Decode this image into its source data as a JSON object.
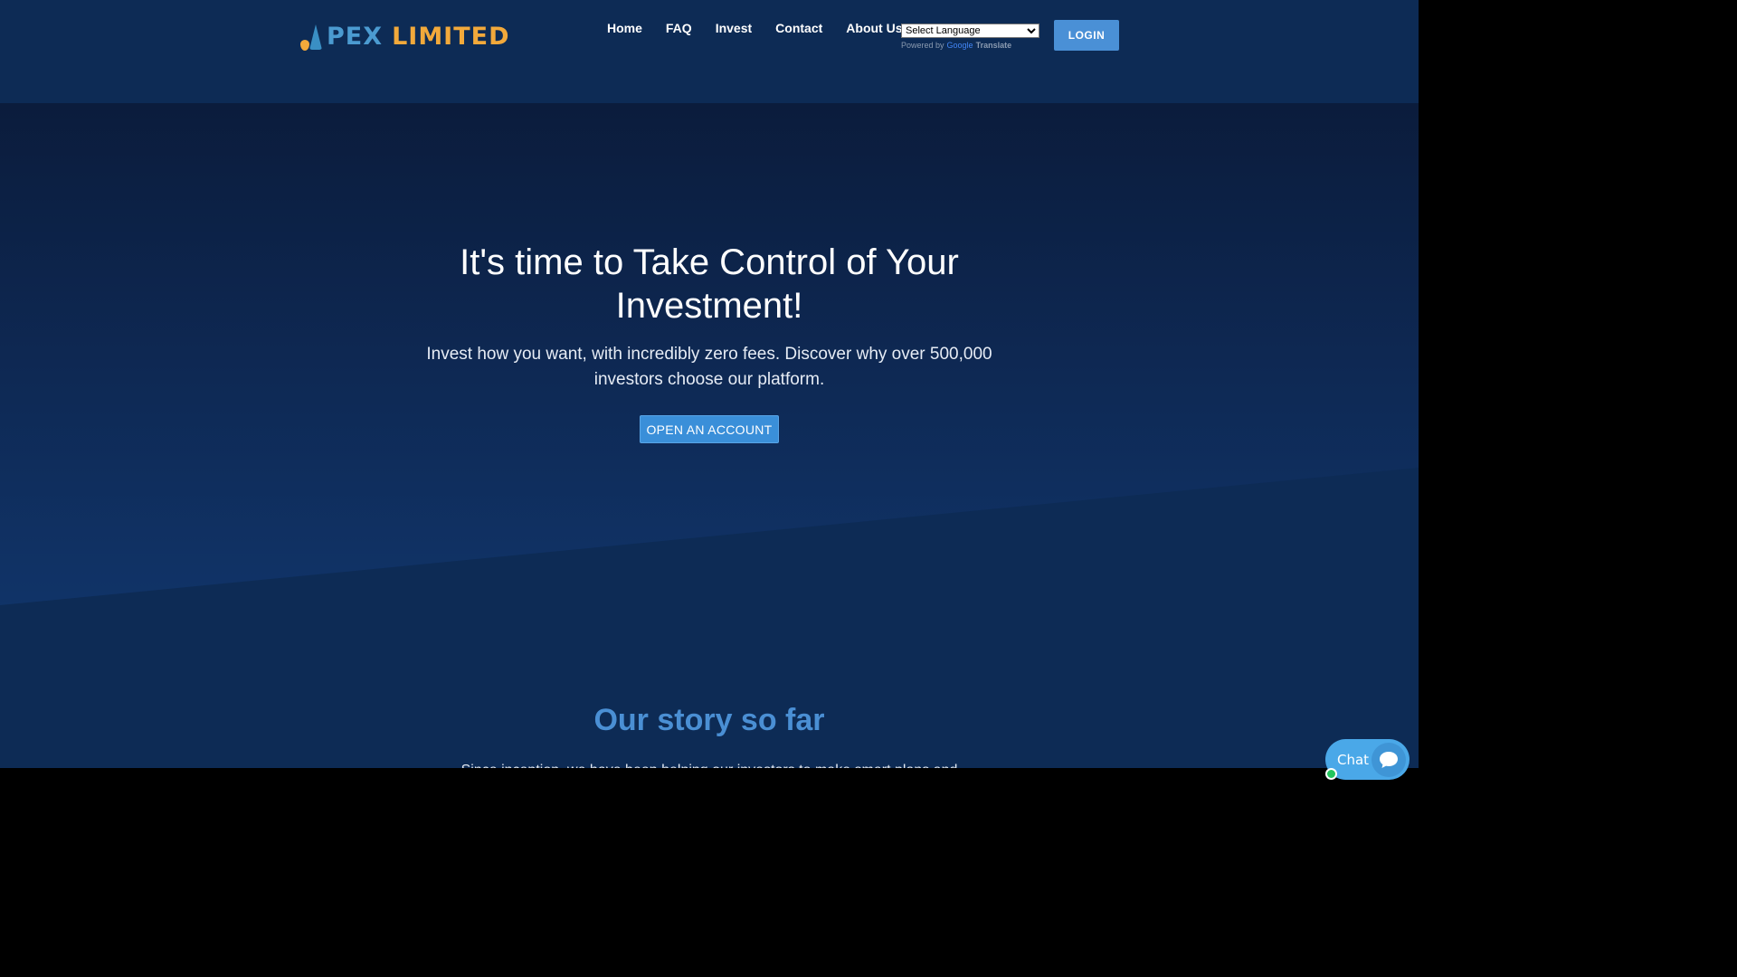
{
  "header": {
    "logo": {
      "part1": "PEX",
      "part2": "LIMITED"
    },
    "nav": [
      {
        "label": "Home"
      },
      {
        "label": "FAQ"
      },
      {
        "label": "Invest"
      },
      {
        "label": "Contact"
      },
      {
        "label": "About Us"
      }
    ],
    "language": {
      "selected": "Select Language",
      "powered_by": "Powered by",
      "google": "Google",
      "translate": "Translate"
    },
    "login_label": "LOGIN"
  },
  "hero": {
    "title": "It's time to Take Control of Your Investment!",
    "subtitle": "Invest how you want, with incredibly zero fees. Discover why over 500,000 investors choose our platform.",
    "cta_label": "OPEN AN ACCOUNT"
  },
  "story": {
    "title": "Our story so far",
    "text": "Since inception, we have been helping our investors to make smart plans and"
  },
  "chat": {
    "label": "Chat"
  },
  "colors": {
    "header_bg": "#0d2b55",
    "accent": "#4a90d6",
    "logo_blue": "#4b9bd1",
    "logo_orange": "#f2a93b",
    "online": "#22c55e"
  }
}
